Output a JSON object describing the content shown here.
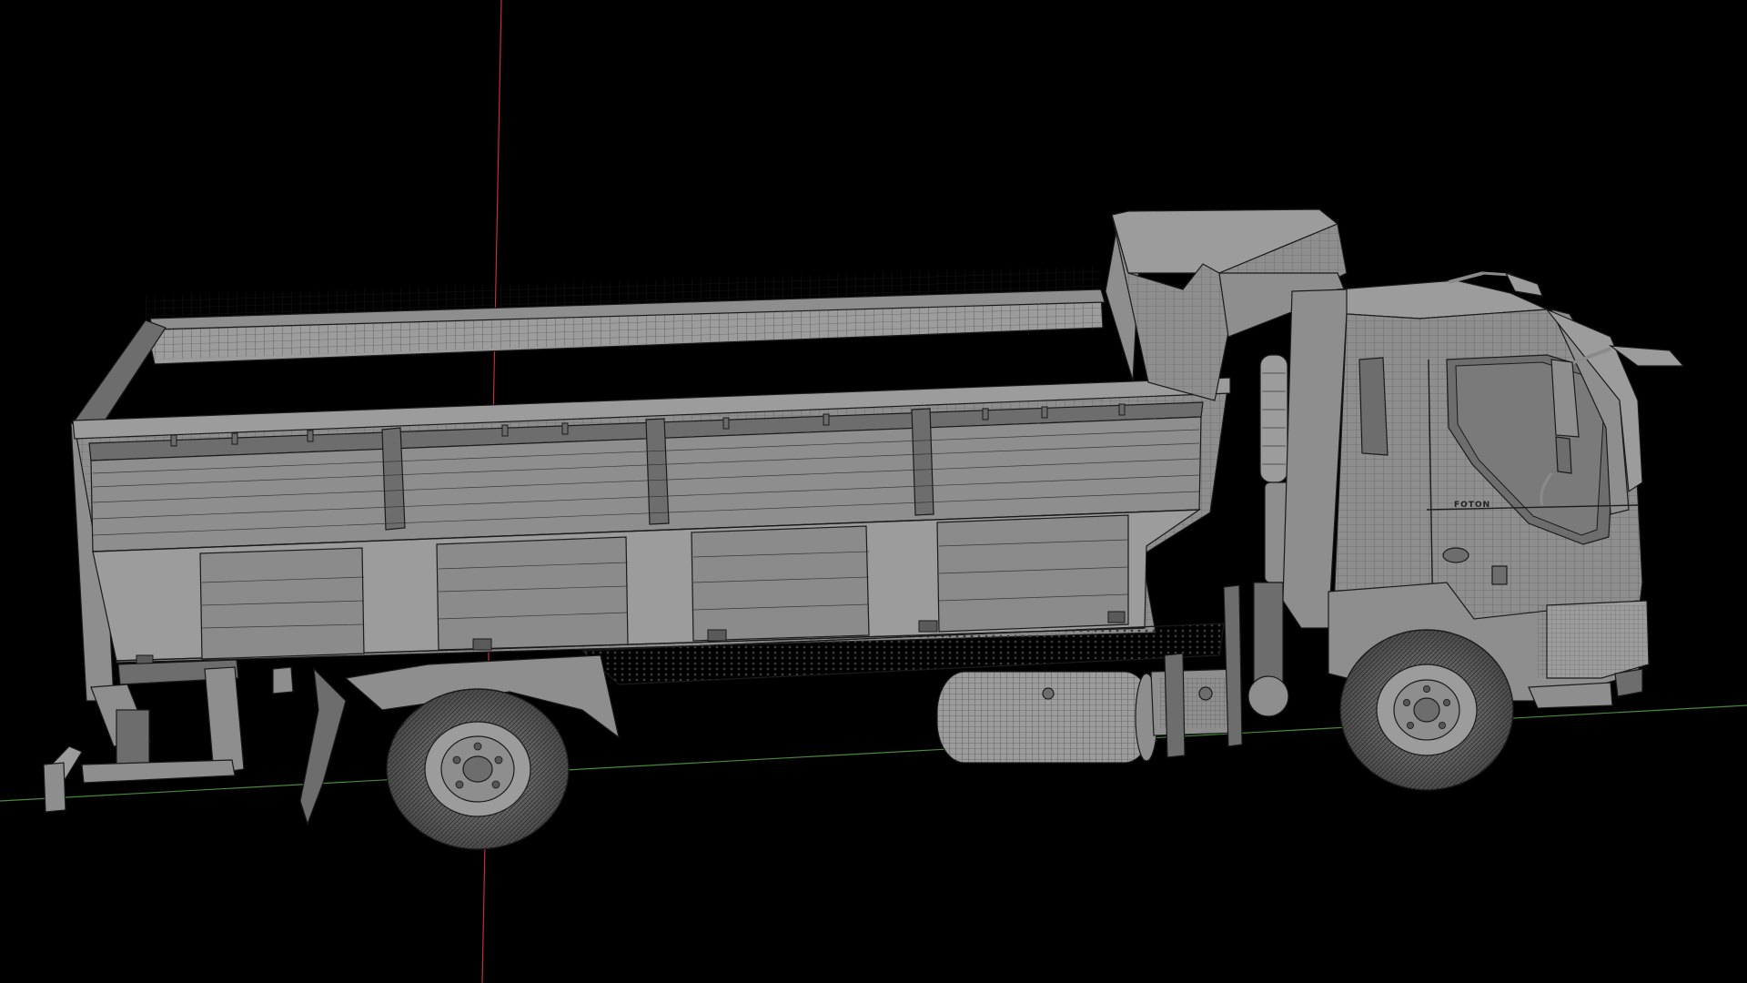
{
  "viewport": {
    "background": "#000000",
    "axis_colors": {
      "y_axis": "#c0303a",
      "x_axis": "#4a8a3a"
    }
  },
  "model": {
    "subject": "dump-truck",
    "display_mode": "wireframe-on-shaded",
    "base_color": "#8e8e8e",
    "edge_color": "#1a1a1a",
    "cab_logo": "FOTON"
  }
}
